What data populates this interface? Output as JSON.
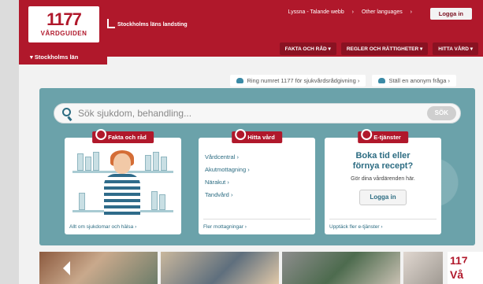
{
  "header": {
    "logo_number": "1177",
    "logo_name": "VÅRDGUIDEN",
    "landsting": "Stockholms läns landsting",
    "toplinks": [
      "Lyssna - Talande webb",
      "Other languages"
    ],
    "login_label": "Logga in",
    "nav": [
      {
        "label": "FAKTA OCH RÅD"
      },
      {
        "label": "REGLER OCH RÄTTIGHETER"
      },
      {
        "label": "HITTA VÅRD"
      }
    ],
    "county": "Stockholms län"
  },
  "links": [
    {
      "label": "Ring numret 1177 för sjukvårdsrådgivning"
    },
    {
      "label": "Ställ en anonym fråga"
    }
  ],
  "search": {
    "placeholder": "Sök sjukdom, behandling...",
    "button": "SÖK"
  },
  "cards": {
    "fakta": {
      "title": "Fakta och råd",
      "footer": "Allt om sjukdomar och hälsa"
    },
    "hitta": {
      "title": "Hitta vård",
      "items": [
        "Vårdcentral",
        "Akutmottagning",
        "Närakut",
        "Tandvård"
      ],
      "footer": "Fler mottagningar"
    },
    "etjanster": {
      "title": "E-tjänster",
      "headline_1": "Boka tid eller",
      "headline_2": "förnya recept?",
      "sub": "Gör dina vårdärenden här.",
      "button": "Logga in",
      "footer": "Upptäck fler e-tjänster"
    }
  },
  "photo_strip": {
    "side_logo_top": "117",
    "side_logo_bottom": "Vå"
  },
  "colors": {
    "brand_red": "#b0182b",
    "panel_teal": "#6ba2aa",
    "link_blue": "#2c6c82"
  }
}
